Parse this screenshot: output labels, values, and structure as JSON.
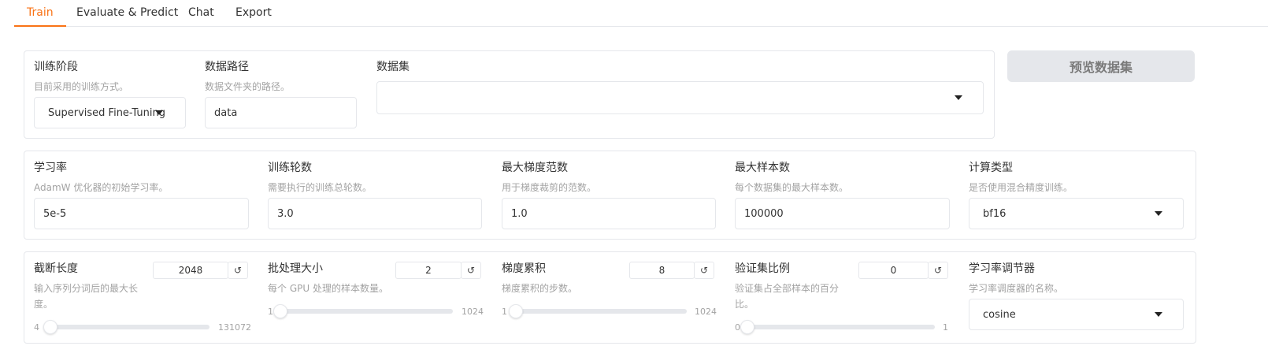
{
  "tabs": [
    "Train",
    "Evaluate & Predict",
    "Chat",
    "Export"
  ],
  "active_tab": "Train",
  "colors": {
    "accent": "#f97316",
    "border": "#e5e7eb",
    "muted_text": "#a3a3a3"
  },
  "row1": {
    "stage": {
      "label": "训练阶段",
      "info": "目前采用的训练方式。",
      "value": "Supervised Fine-Tuning"
    },
    "data_path": {
      "label": "数据路径",
      "info": "数据文件夹的路径。",
      "value": "data"
    },
    "dataset": {
      "label": "数据集",
      "value": ""
    },
    "preview_button": "预览数据集"
  },
  "row2": {
    "learning_rate": {
      "label": "学习率",
      "info": "AdamW 优化器的初始学习率。",
      "value": "5e-5"
    },
    "epochs": {
      "label": "训练轮数",
      "info": "需要执行的训练总轮数。",
      "value": "3.0"
    },
    "max_grad_norm": {
      "label": "最大梯度范数",
      "info": "用于梯度裁剪的范数。",
      "value": "1.0"
    },
    "max_samples": {
      "label": "最大样本数",
      "info": "每个数据集的最大样本数。",
      "value": "100000"
    },
    "compute_type": {
      "label": "计算类型",
      "info": "是否使用混合精度训练。",
      "value": "bf16"
    }
  },
  "row3": {
    "cutoff_len": {
      "label": "截断长度",
      "info": "输入序列分词后的最大长度。",
      "value": "2048",
      "min": "4",
      "max": "131072",
      "fraction": 0.015
    },
    "batch_size": {
      "label": "批处理大小",
      "info": "每个 GPU 处理的样本数量。",
      "value": "2",
      "min": "1",
      "max": "1024",
      "fraction": 0.001
    },
    "grad_accum": {
      "label": "梯度累积",
      "info": "梯度累积的步数。",
      "value": "8",
      "min": "1",
      "max": "1024",
      "fraction": 0.007
    },
    "val_size": {
      "label": "验证集比例",
      "info": "验证集占全部样本的百分比。",
      "value": "0",
      "min": "0",
      "max": "1",
      "fraction": 0.0
    },
    "lr_scheduler": {
      "label": "学习率调节器",
      "info": "学习率调度器的名称。",
      "value": "cosine"
    }
  },
  "icons": {
    "reset": "reset-icon",
    "dropdown": "chevron-down-icon"
  }
}
